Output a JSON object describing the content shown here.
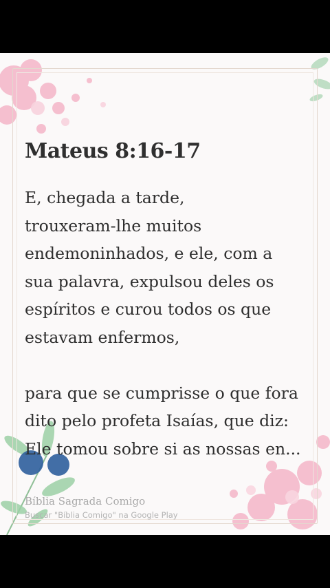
{
  "reference": "Mateus 8:16-17",
  "verse_text": "E, chegada a tarde,\ntrouxeram-lhe muitos\nendemoninhados, e ele, com a\nsua palavra, expulsou deles os\nespíritos e curou todos os que\nestavam enfermos,\n\npara que se cumprisse o que fora\ndito pelo profeta Isaías, que diz:\nEle tomou sobre si as nossas en...",
  "app_name": "Bíblia Sagrada Comigo",
  "app_hint": "Buscar \"Bíblia Comigo\" na Google Play",
  "colors": {
    "background": "#000000",
    "card": "#fbf9f9",
    "text": "#2e2e2e",
    "flower_pink": "#f4b6c8",
    "leaf_green": "#9dd1a6",
    "berry_blue": "#2f5f9e"
  }
}
